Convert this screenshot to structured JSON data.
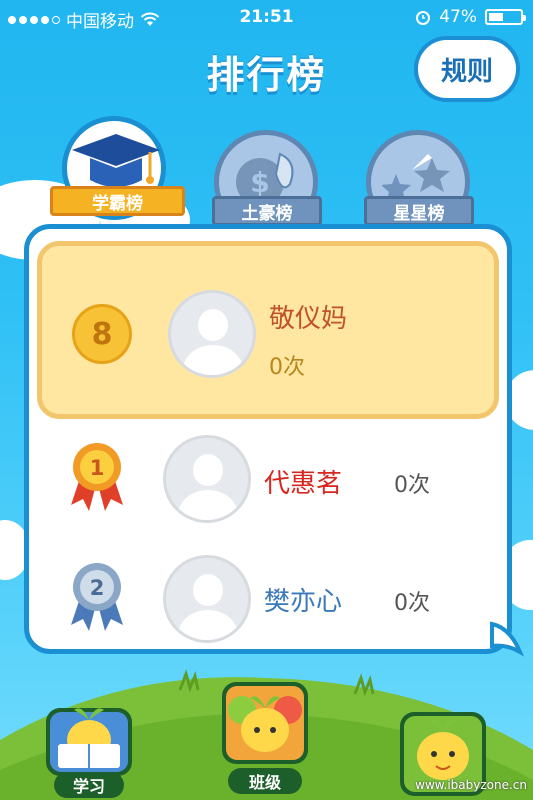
{
  "status_bar": {
    "carrier": "中国移动",
    "time": "21:51",
    "battery": "47%",
    "battery_level": 0.47
  },
  "header": {
    "title": "排行榜",
    "rules_label": "规则"
  },
  "tabs": [
    {
      "label": "学霸榜",
      "active": true,
      "icon": "graduation-cap-icon"
    },
    {
      "label": "土豪榜",
      "active": false,
      "icon": "money-bag-icon"
    },
    {
      "label": "星星榜",
      "active": false,
      "icon": "stars-icon"
    }
  ],
  "ranking": {
    "me": {
      "rank": "8",
      "name": "敬仪妈",
      "count": "0次"
    },
    "rows": [
      {
        "rank": "1",
        "name": "代惠茗",
        "count": "0次",
        "medal": "gold"
      },
      {
        "rank": "2",
        "name": "樊亦心",
        "count": "0次",
        "medal": "silver"
      }
    ]
  },
  "bottom_nav": [
    {
      "label": "学习",
      "icon": "reading-sprout-icon"
    },
    {
      "label": "班级",
      "icon": "fruit-sprout-icon"
    },
    {
      "label": "",
      "icon": "sprout-mascot-icon"
    }
  ],
  "watermark": "www.ibabyzone.cn",
  "colors": {
    "sky": "#2fc0f5",
    "card_border": "#1a8fd1",
    "highlight_row": "#ffe7a1",
    "name_me": "#c0522a",
    "name_first": "#d6261f",
    "name_second": "#3a78b8"
  }
}
